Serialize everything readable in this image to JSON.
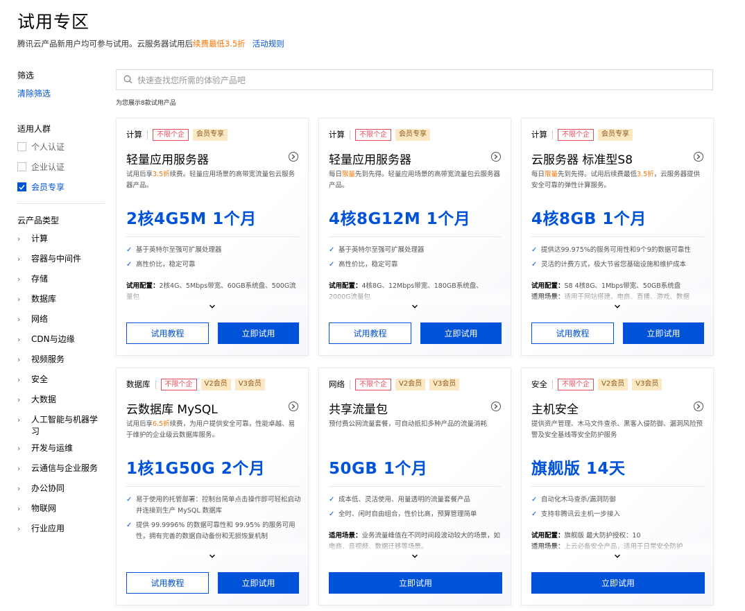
{
  "page": {
    "title": "试用专区",
    "subtitle_prefix": "腾讯云产品新用户均可参与试用。云服务器试用后",
    "subtitle_highlight": "续费最低3.5折",
    "rules_link": "活动规则"
  },
  "sidebar": {
    "filter_title": "筛选",
    "clear": "清除筛选",
    "audience_title": "适用人群",
    "audience": [
      {
        "label": "个人认证",
        "checked": false
      },
      {
        "label": "企业认证",
        "checked": false
      },
      {
        "label": "会员专享",
        "checked": true
      }
    ],
    "category_title": "云产品类型",
    "categories": [
      "计算",
      "容器与中间件",
      "存储",
      "数据库",
      "网络",
      "CDN与边缘",
      "视频服务",
      "安全",
      "大数据",
      "人工智能与机器学习",
      "开发与运维",
      "云通信与企业服务",
      "办公协同",
      "物联网",
      "行业应用"
    ]
  },
  "search": {
    "placeholder": "快速查找您所需的体验产品吧",
    "icon": "search-icon"
  },
  "result_count": "为您展示8款试用产品",
  "colors": {
    "accent": "#0052d9",
    "highlight": "#ff7200",
    "tag_red": "#e34d59",
    "tag_vip_bg": "#fde8c3"
  },
  "cards": [
    {
      "category": "计算",
      "tags": [
        {
          "text": "不限个企",
          "style": "red"
        },
        {
          "text": "会员专享",
          "style": "vip"
        }
      ],
      "name": "轻量应用服务器",
      "desc_a": "试用后享",
      "desc_hl": "3.5折",
      "desc_b": "续费。轻量应用场景的高带宽流量包云服务器产品。",
      "price": "2核4G5M  1个月",
      "features": [
        "基于英特尔至强可扩展处理器",
        "高性价比，稳定可靠"
      ],
      "conf_label": "试用配置：",
      "conf_text": "2核4G、5Mbps带宽、60GB系统盘、500G流量包",
      "buttons": [
        "试用教程",
        "立即试用"
      ]
    },
    {
      "category": "计算",
      "tags": [
        {
          "text": "不限个企",
          "style": "red"
        },
        {
          "text": "会员专享",
          "style": "vip"
        }
      ],
      "name": "轻量应用服务器",
      "desc_a": "每日",
      "desc_hl": "限量",
      "desc_b": "先到先得。轻量应用场景的高带宽流量包云服务器产品。",
      "price": "4核8G12M  1个月",
      "features": [
        "基于英特尔至强可扩展处理器",
        "高性价比，稳定可靠"
      ],
      "conf_label": "试用配置：",
      "conf_text": "4核8G、12Mbps带宽、180GB系统盘、2000G流量包",
      "buttons": [
        "试用教程",
        "立即试用"
      ]
    },
    {
      "category": "计算",
      "tags": [
        {
          "text": "不限个企",
          "style": "red"
        },
        {
          "text": "会员专享",
          "style": "vip"
        }
      ],
      "name": "云服务器 标准型S8",
      "desc_a": "每日",
      "desc_hl": "限量",
      "desc_b": "先到先得。试用后续费最低",
      "desc_hl2": "3.5折",
      "desc_c": "，云服务器提供安全可靠的弹性计算服务。",
      "price": "4核8GB  1个月",
      "features": [
        "提供达99.975%的服务可用性和9个9的数据可靠性",
        "灵活的计费方式，极大节省您基础设施和维护成本"
      ],
      "conf_label": "试用配置：",
      "conf_text": "S8 4核8G、1Mbps带宽、50GB系统盘",
      "conf_label2": "适用场景：",
      "conf_text2": "适用于网站搭建、电商、直播、游戏、数据",
      "buttons": [
        "试用教程",
        "立即试用"
      ]
    },
    {
      "category": "数据库",
      "tags": [
        {
          "text": "不限个企",
          "style": "red"
        },
        {
          "text": "V2会员",
          "style": "vip"
        },
        {
          "text": "V3会员",
          "style": "vip"
        }
      ],
      "name": "云数据库 MySQL",
      "desc_a": "试用后享",
      "desc_hl": "6.5折",
      "desc_b": "续费，为用户提供安全可靠，性能卓越、易于维护的企业级云数据库服务。",
      "price": "1核1G50G  2个月",
      "features": [
        "易于使用的托管部署：控制台简单点击操作即可轻松启动并连接到生产 MySQL 数据库",
        "提供 99.9996% 的数据可靠性和 99.95% 的服务可用性，拥有完善的数据自动备份和无损恢复机制"
      ],
      "buttons": [
        "试用教程",
        "立即试用"
      ]
    },
    {
      "category": "网络",
      "tags": [
        {
          "text": "不限个企",
          "style": "red"
        },
        {
          "text": "V2会员",
          "style": "vip"
        },
        {
          "text": "V3会员",
          "style": "vip"
        }
      ],
      "name": "共享流量包",
      "desc_a": "预付费公网流量套餐，可自动抵扣多种产品的流量消耗",
      "price": "50GB  1个月",
      "features": [
        "成本低、灵活使用、用量透明的流量套餐产品",
        "全时、闲时自由组合，性价比高，预算管理简单"
      ],
      "conf_label": "适用场景：",
      "conf_text": "业务流量峰值在不同时间段波动较大的场景，如电商、音视频、数据迁移等场景。",
      "buttons": [
        "立即试用"
      ]
    },
    {
      "category": "安全",
      "tags": [
        {
          "text": "不限个企",
          "style": "red"
        },
        {
          "text": "V2会员",
          "style": "vip"
        },
        {
          "text": "V3会员",
          "style": "vip"
        }
      ],
      "name": "主机安全",
      "desc_a": "提供资产管理、木马文件查杀、黑客入侵防御、漏洞风险预警及安全基线等安全防护服务",
      "price": "旗舰版  14天",
      "features": [
        "自动化木马查杀/漏洞防御",
        "支持非腾讯云主机一步接入"
      ],
      "conf_label": "试用配置：",
      "conf_text": "旗舰版 最大防护授权：10",
      "conf_label2": "适用场景：",
      "conf_text2": "上云必备安全产品，适用于日常安全防护",
      "buttons": [
        "立即试用"
      ]
    }
  ]
}
